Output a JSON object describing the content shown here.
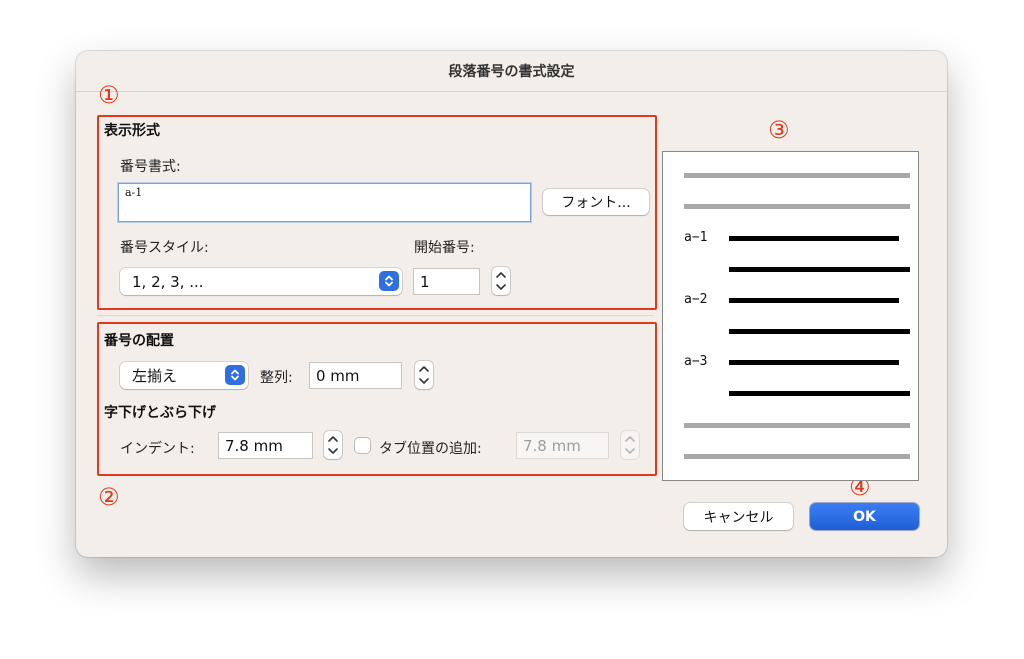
{
  "dialog": {
    "title": "段落番号の書式設定"
  },
  "markers": [
    "①",
    "②",
    "③",
    "④"
  ],
  "display_format": {
    "section_title": "表示形式",
    "number_format_label": "番号書式:",
    "number_format_value": "a-1",
    "font_button": "フォント...",
    "number_style_label": "番号スタイル:",
    "number_style_value": "1, 2, 3, ...",
    "start_number_label": "開始番号:",
    "start_number_value": "1"
  },
  "number_position": {
    "section_title": "番号の配置",
    "alignment_value": "左揃え",
    "align_at_label": "整列:",
    "align_at_value": "0 mm",
    "indent_section_title": "字下げとぶら下げ",
    "indent_label": "インデント:",
    "indent_value": "7.8 mm",
    "add_tab_label": "タブ位置の追加:",
    "add_tab_value": "7.8 mm",
    "add_tab_checked": false
  },
  "preview": {
    "items": [
      "a−1",
      "a−2",
      "a−3"
    ]
  },
  "buttons": {
    "cancel": "キャンセル",
    "ok": "OK"
  },
  "colors": {
    "annotation_red": "#e03a1e",
    "accent_blue": "#2f6fe0",
    "dialog_bg": "#f3eeea"
  },
  "icons": {
    "popup_arrows": "up-down-chevron-icon",
    "stepper": "stepper-icon"
  }
}
